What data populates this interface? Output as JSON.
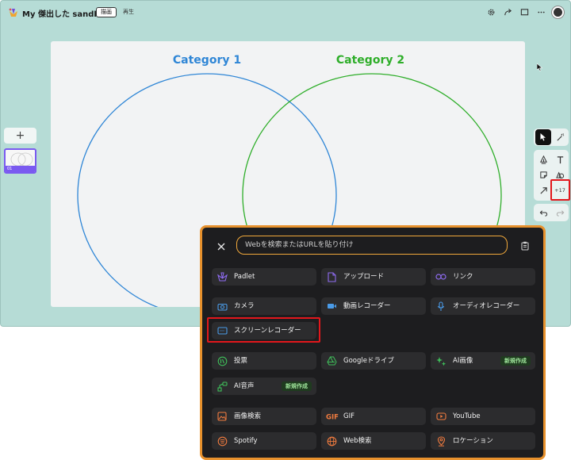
{
  "header": {
    "title": "My 傑出した sandbox",
    "tab_draw": "描画",
    "tab_play": "再生"
  },
  "icons": {
    "logo": "padlet-logo-icon",
    "top": [
      "gear-icon",
      "share-icon",
      "present-icon",
      "more-icon"
    ],
    "avatar": "avatar"
  },
  "canvas": {
    "category1": "Category 1",
    "category2": "Category 2",
    "category1_color": "#2f86d6",
    "category2_color": "#2fae2a"
  },
  "slides": {
    "add_label": "+",
    "items": [
      {
        "number": "01"
      }
    ]
  },
  "tools": {
    "more_count": "+17"
  },
  "panel": {
    "search_placeholder": "Webを検索またはURLを貼り付け",
    "new_badge": "新規作成",
    "items": [
      {
        "label": "Padlet",
        "icon": "padlet-icon"
      },
      {
        "label": "アップロード",
        "icon": "upload-icon"
      },
      {
        "label": "リンク",
        "icon": "link-icon"
      },
      {
        "label": "カメラ",
        "icon": "camera-icon"
      },
      {
        "label": "動画レコーダー",
        "icon": "video-recorder-icon"
      },
      {
        "label": "オーディオレコーダー",
        "icon": "microphone-icon"
      },
      {
        "label": "スクリーンレコーダー",
        "icon": "screen-recorder-icon"
      },
      {
        "label": "投票",
        "icon": "poll-icon"
      },
      {
        "label": "Googleドライブ",
        "icon": "google-drive-icon"
      },
      {
        "label": "AI画像",
        "icon": "ai-image-icon"
      },
      {
        "label": "AI音声",
        "icon": "ai-voice-icon"
      },
      {
        "label": "画像検索",
        "icon": "image-search-icon"
      },
      {
        "label": "GIF",
        "icon": "gif-icon"
      },
      {
        "label": "YouTube",
        "icon": "youtube-icon"
      },
      {
        "label": "Spotify",
        "icon": "spotify-icon"
      },
      {
        "label": "Web検索",
        "icon": "web-search-icon"
      },
      {
        "label": "ロケーション",
        "icon": "location-icon"
      }
    ]
  },
  "colors": {
    "app_bg": "#b6dcd6",
    "panel_border": "#e7912d",
    "search_border": "#f2a93b",
    "highlight": "#e2171c"
  }
}
